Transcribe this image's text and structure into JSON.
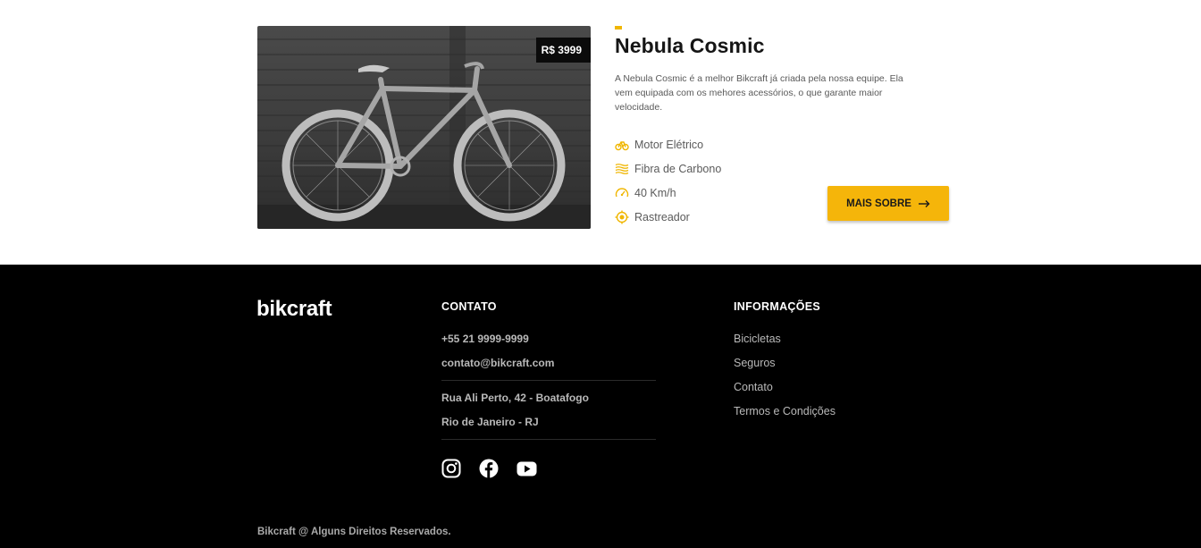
{
  "product": {
    "price": "R$ 3999",
    "title": "Nebula Cosmic",
    "description": "A Nebula Cosmic é a melhor Bikcraft já criada pela nossa equipe. Ela vem equipada com os mehores acessórios, o que garante maior velocidade.",
    "features": [
      {
        "icon": "electric-bike-icon",
        "label": "Motor Elétrico"
      },
      {
        "icon": "carbon-fiber-icon",
        "label": "Fibra de Carbono"
      },
      {
        "icon": "speedometer-icon",
        "label": "40 Km/h"
      },
      {
        "icon": "tracker-icon",
        "label": "Rastreador"
      }
    ],
    "button_label": "MAIS SOBRE",
    "accent_color": "#f5b50a"
  },
  "footer": {
    "logo": "bikcraft",
    "contact": {
      "title": "CONTATO",
      "phone": "+55 21 9999-9999",
      "email": "contato@bikcraft.com",
      "address_line1": "Rua Ali Perto, 42 - Boatafogo",
      "address_line2": "Rio de Janeiro - RJ",
      "social": [
        "instagram-icon",
        "facebook-icon",
        "youtube-icon"
      ]
    },
    "info": {
      "title": "INFORMAÇÕES",
      "links": [
        "Bicicletas",
        "Seguros",
        "Contato",
        "Termos e Condições"
      ]
    },
    "copyright": "Bikcraft @ Alguns Direitos Reservados."
  }
}
